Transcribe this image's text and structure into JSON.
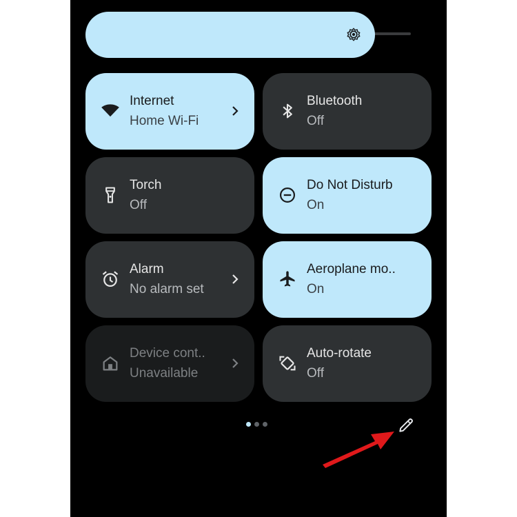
{
  "colors": {
    "accent": "#bfe8fb",
    "tile_off": "#2e3133",
    "tile_unavailable": "#1a1c1d",
    "annotation_arrow": "#e0191b"
  },
  "brightness": {
    "icon": "brightness-icon",
    "level": 0.8
  },
  "tiles": [
    {
      "label": "Internet",
      "status": "Home Wi-Fi",
      "icon": "wifi-icon",
      "state": "on",
      "has_chevron": true
    },
    {
      "label": "Bluetooth",
      "status": "Off",
      "icon": "bluetooth-icon",
      "state": "off",
      "has_chevron": false
    },
    {
      "label": "Torch",
      "status": "Off",
      "icon": "torch-icon",
      "state": "off",
      "has_chevron": false
    },
    {
      "label": "Do Not Disturb",
      "status": "On",
      "icon": "do-not-disturb-icon",
      "state": "on",
      "has_chevron": false
    },
    {
      "label": "Alarm",
      "status": "No alarm set",
      "icon": "alarm-icon",
      "state": "off",
      "has_chevron": true
    },
    {
      "label": "Aeroplane mo..",
      "status": "On",
      "icon": "airplane-icon",
      "state": "on",
      "has_chevron": false
    },
    {
      "label": "Device cont..",
      "status": "Unavailable",
      "icon": "home-icon",
      "state": "unavailable",
      "has_chevron": true
    },
    {
      "label": "Auto-rotate",
      "status": "Off",
      "icon": "auto-rotate-icon",
      "state": "off",
      "has_chevron": false
    }
  ],
  "pager": {
    "pages": 3,
    "current": 1
  },
  "edit": {
    "icon": "pencil-icon"
  }
}
